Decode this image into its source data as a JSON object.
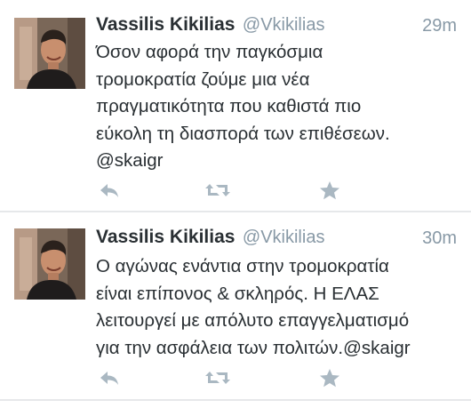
{
  "colors": {
    "icon": "#aab8c2",
    "handle": "#8899a6",
    "text": "#292f33",
    "divider": "#e6e8ea"
  },
  "tweets": [
    {
      "display_name": "Vassilis Kikilias",
      "handle": "@Vkikilias",
      "timestamp": "29m",
      "text": "Όσον αφορά την παγκόσμια\nτρομοκρατία ζούμε μια νέα\nπραγματικότητα που καθιστά πιο\nεύκολη τη διασπορά των επιθέσεων.\n@skaigr",
      "actions": {
        "reply": "reply-icon",
        "retweet": "retweet-icon",
        "favorite": "star-icon"
      }
    },
    {
      "display_name": "Vassilis Kikilias",
      "handle": "@Vkikilias",
      "timestamp": "30m",
      "text": "Ο αγώνας ενάντια στην τρομοκρατία\nείναι επίπονος & σκληρός. Η ΕΛΑΣ\nλειτουργεί με απόλυτο επαγγελματισμό\nγια την ασφάλεια των πολιτών.@skaigr",
      "actions": {
        "reply": "reply-icon",
        "retweet": "retweet-icon",
        "favorite": "star-icon"
      }
    }
  ]
}
